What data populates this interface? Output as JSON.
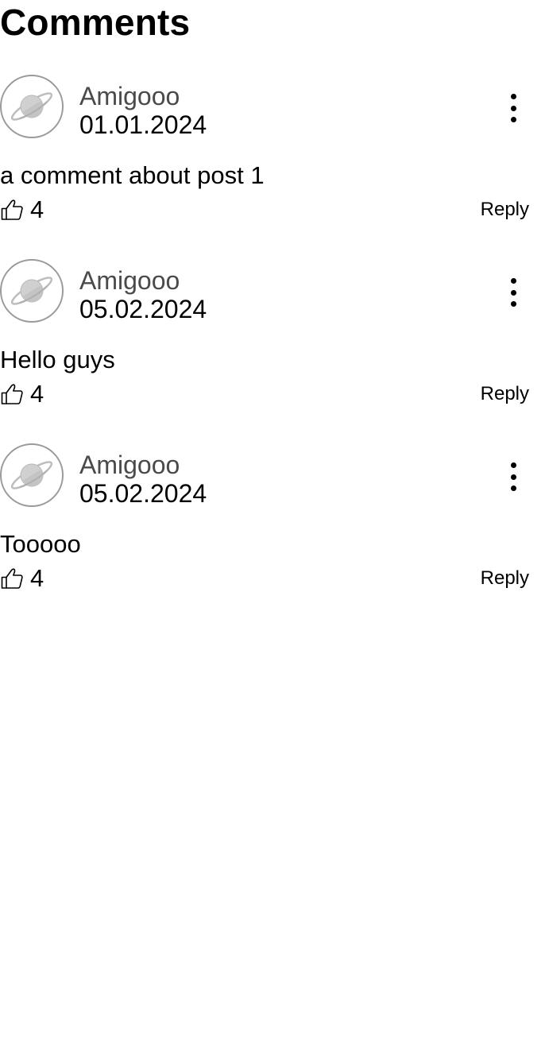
{
  "header": {
    "title": "Comments"
  },
  "comments": [
    {
      "author": "Amigooo",
      "date": "01.01.2024",
      "text": "a comment about post 1",
      "likes": "4",
      "reply_label": "Reply",
      "avatar_icon": "planet-icon"
    },
    {
      "author": "Amigooo",
      "date": "05.02.2024",
      "text": "Hello guys",
      "likes": "4",
      "reply_label": "Reply",
      "avatar_icon": "planet-icon"
    },
    {
      "author": "Amigooo",
      "date": "05.02.2024",
      "text": "Tooooo",
      "likes": "4",
      "reply_label": "Reply",
      "avatar_icon": "planet-icon"
    }
  ],
  "icons": {
    "like": "thumbs-up-icon",
    "menu": "more-vertical-icon"
  },
  "colors": {
    "author": "#4a4a4a",
    "avatar_border": "#9a9a9a",
    "text": "#000000"
  }
}
